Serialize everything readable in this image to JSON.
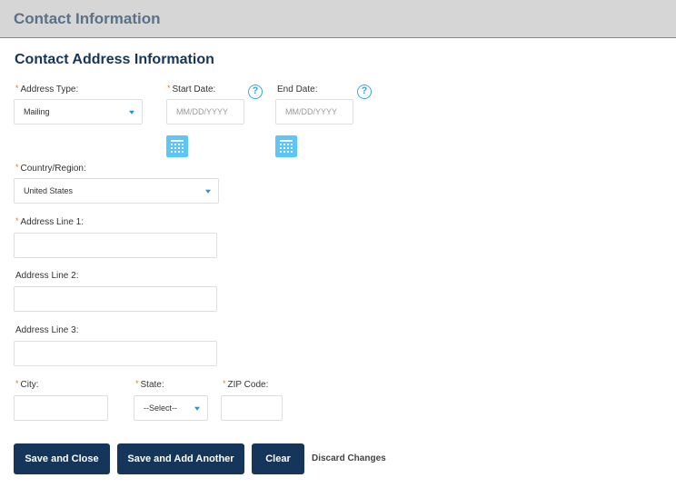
{
  "header": {
    "title": "Contact Information"
  },
  "section": {
    "title": "Contact Address Information"
  },
  "required_marker": "*",
  "fields": {
    "address_type": {
      "label": "Address Type:",
      "required": true,
      "value": "Mailing"
    },
    "start_date": {
      "label": "Start Date:",
      "required": true,
      "value": "",
      "placeholder": "MM/DD/YYYY"
    },
    "end_date": {
      "label": "End Date:",
      "required": false,
      "value": "",
      "placeholder": "MM/DD/YYYY"
    },
    "country": {
      "label": "Country/Region:",
      "required": true,
      "value": "United States"
    },
    "address_line_1": {
      "label": "Address Line 1:",
      "required": true,
      "value": ""
    },
    "address_line_2": {
      "label": "Address Line 2:",
      "required": false,
      "value": ""
    },
    "address_line_3": {
      "label": "Address Line 3:",
      "required": false,
      "value": ""
    },
    "city": {
      "label": "City:",
      "required": true,
      "value": ""
    },
    "state": {
      "label": "State:",
      "required": true,
      "value": "--Select--"
    },
    "zip": {
      "label": "ZIP Code:",
      "required": true,
      "value": ""
    }
  },
  "help_glyph": "?",
  "icons": {
    "help": "help-circle-icon",
    "calendar": "calendar-icon",
    "dropdown": "chevron-down-icon"
  },
  "buttons": {
    "save_close": "Save and Close",
    "save_add": "Save and Add Another",
    "clear": "Clear",
    "discard": "Discard Changes"
  },
  "colors": {
    "primary": "#15365a",
    "header_bg": "#d6d6d6",
    "header_text": "#5a7189",
    "required": "#e07b1f",
    "accent": "#5bc6f7",
    "help": "#3aa8e0"
  }
}
